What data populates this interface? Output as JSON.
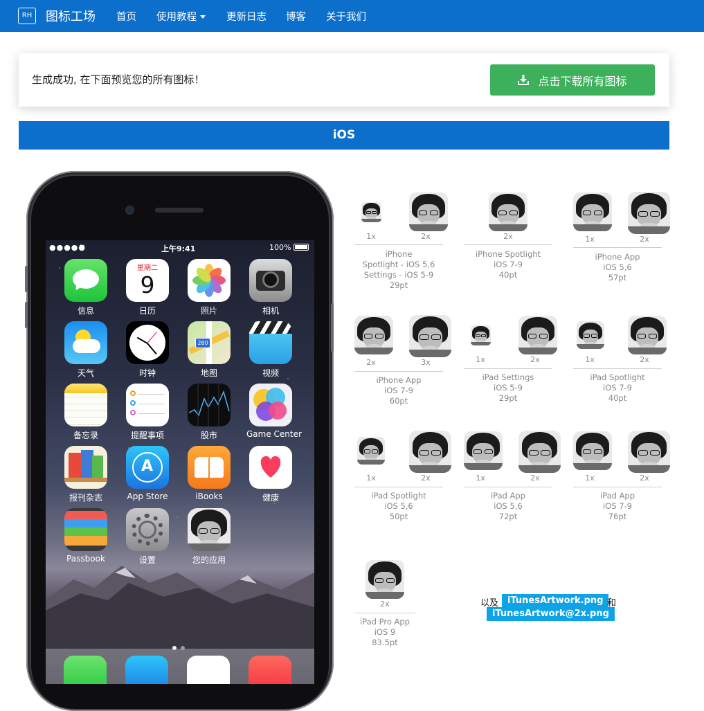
{
  "navbar": {
    "logo_text": "RH",
    "brand": "图标工场",
    "items": [
      {
        "label": "首页"
      },
      {
        "label": "使用教程",
        "dropdown": true
      },
      {
        "label": "更新日志"
      },
      {
        "label": "博客"
      },
      {
        "label": "关于我们"
      }
    ],
    "color": "#0c6fcc"
  },
  "success": {
    "message": "生成成功, 在下面预览您的所有图标！",
    "download_label": "点击下载所有图标",
    "download_icon": "download-icon",
    "button_color": "#3cb05a"
  },
  "section": {
    "title": "iOS"
  },
  "phone": {
    "status": {
      "signal": "●●●●●",
      "time": "上午9:41",
      "battery": "100%"
    },
    "apps": [
      {
        "label": "信息"
      },
      {
        "label": "日历",
        "weekday": "星期二",
        "day": "9"
      },
      {
        "label": "照片"
      },
      {
        "label": "相机"
      },
      {
        "label": "天气"
      },
      {
        "label": "时钟"
      },
      {
        "label": "地图",
        "badge": "280"
      },
      {
        "label": "视频"
      },
      {
        "label": "备忘录"
      },
      {
        "label": "提醒事项"
      },
      {
        "label": "股市"
      },
      {
        "label": "Game Center"
      },
      {
        "label": "报刊杂志"
      },
      {
        "label": "App Store"
      },
      {
        "label": "iBooks"
      },
      {
        "label": "健康"
      },
      {
        "label": "Passbook"
      },
      {
        "label": "设置"
      },
      {
        "label": "您的应用"
      }
    ]
  },
  "icon_groups": [
    {
      "sizes": [
        "1x",
        "2x"
      ],
      "desc": [
        "iPhone",
        "Spotlight - iOS 5,6",
        "Settings - iOS 5-9",
        "29pt"
      ]
    },
    {
      "sizes": [
        "2x"
      ],
      "desc": [
        "iPhone Spotlight",
        "iOS 7-9",
        "40pt"
      ]
    },
    {
      "sizes": [
        "1x",
        "2x"
      ],
      "desc": [
        "iPhone App",
        "iOS 5,6",
        "57pt"
      ]
    },
    {
      "sizes": [
        "2x",
        "3x"
      ],
      "desc": [
        "iPhone App",
        "iOS 7-9",
        "60pt"
      ]
    },
    {
      "sizes": [
        "1x",
        "2x"
      ],
      "desc": [
        "iPad Settings",
        "iOS 5-9",
        "29pt"
      ]
    },
    {
      "sizes": [
        "1x",
        "2x"
      ],
      "desc": [
        "iPad Spotlight",
        "iOS 7-9",
        "40pt"
      ]
    },
    {
      "sizes": [
        "1x",
        "2x"
      ],
      "desc": [
        "iPad Spotlight",
        "iOS 5,6",
        "50pt"
      ]
    },
    {
      "sizes": [
        "1x",
        "2x"
      ],
      "desc": [
        "iPad App",
        "iOS 5,6",
        "72pt"
      ]
    },
    {
      "sizes": [
        "1x",
        "2x"
      ],
      "desc": [
        "iPad App",
        "iOS 7-9",
        "76pt"
      ]
    },
    {
      "sizes": [
        "2x"
      ],
      "desc": [
        "iPad Pro App",
        "iOS 9",
        "83.5pt"
      ]
    }
  ],
  "artwork": {
    "prefix": "以及",
    "file1": "iTunesArtwork.png",
    "conj": "和",
    "file2": "iTunesArtwork@2x.png"
  }
}
